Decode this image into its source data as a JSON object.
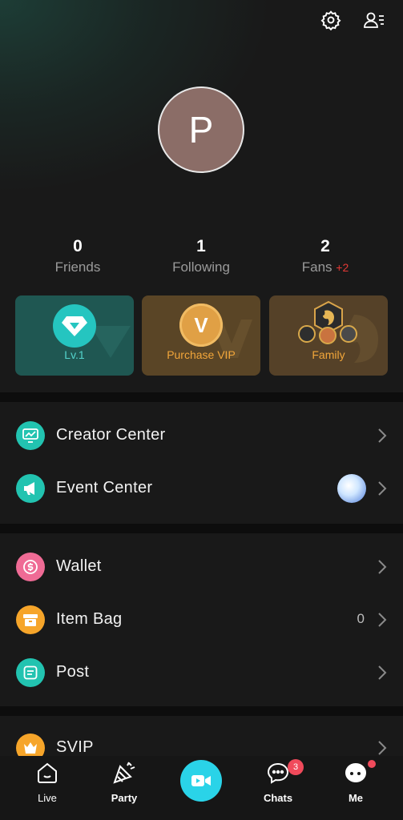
{
  "profile": {
    "avatar_initial": "P"
  },
  "stats": [
    {
      "value": "0",
      "label": "Friends"
    },
    {
      "value": "1",
      "label": "Following"
    },
    {
      "value": "2",
      "label": "Fans",
      "delta": "+2"
    }
  ],
  "cards": {
    "level": "Lv.1",
    "vip": "Purchase VIP",
    "vip_letter": "V",
    "family": "Family"
  },
  "menu": {
    "creator_center": "Creator Center",
    "event_center": "Event Center",
    "wallet": "Wallet",
    "item_bag": "Item Bag",
    "item_bag_count": "0",
    "post": "Post",
    "svip": "SVIP"
  },
  "nav": {
    "live": "Live",
    "party": "Party",
    "chats": "Chats",
    "chats_badge": "3",
    "me": "Me"
  },
  "colors": {
    "teal": "#22c3b0",
    "vip_gold": "#e8a23a",
    "wallet_pink": "#ef6b95",
    "item_bag_orange": "#f6a52a",
    "badge_red": "#f04a5b",
    "record_cyan": "#2ad3e8"
  }
}
